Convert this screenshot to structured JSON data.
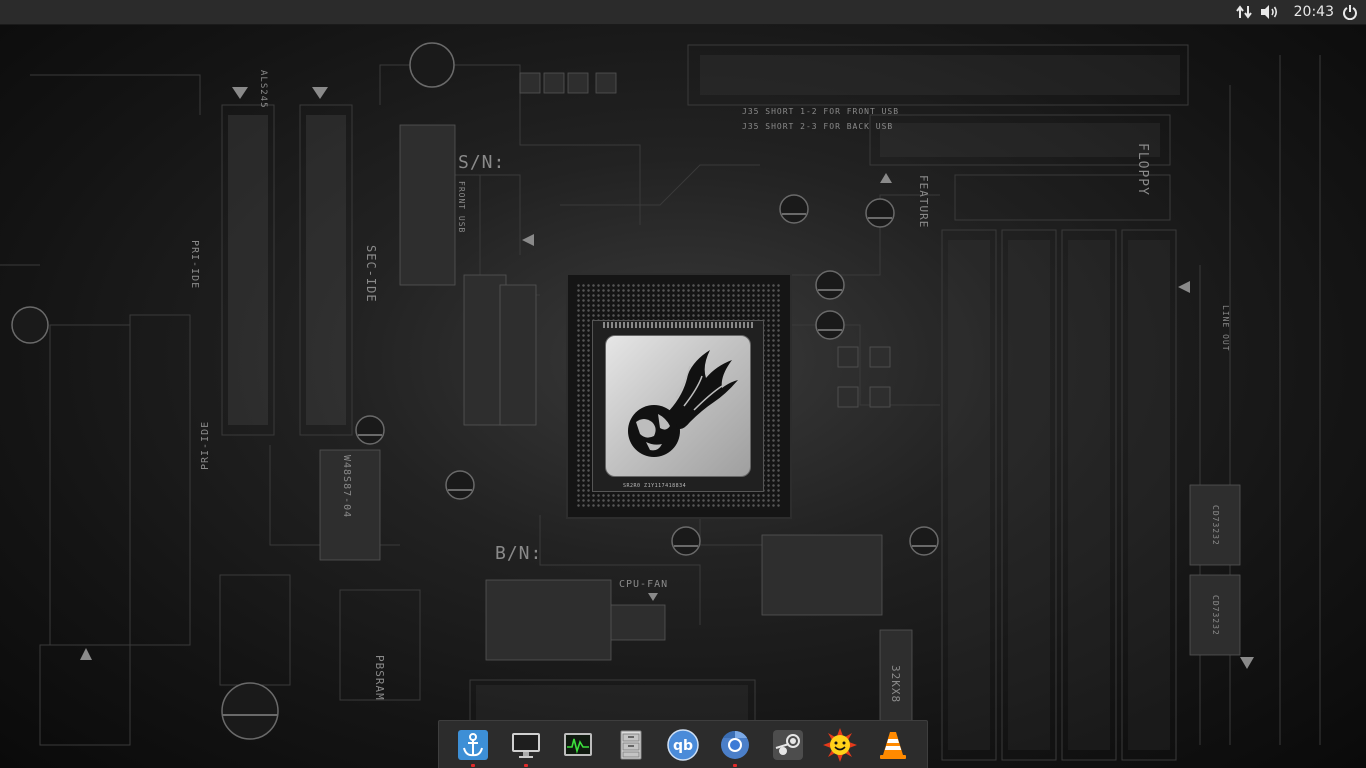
{
  "panel": {
    "clock": "20:43",
    "icons": {
      "network": "network-transfer-icon",
      "volume": "volume-icon",
      "power": "power-icon"
    }
  },
  "wallpaper": {
    "labels": {
      "sn": "S/N:",
      "bn": "B/N:",
      "floppy": "FLOPPY",
      "feature": "FEATURE",
      "sec_ide": "SEC-IDE",
      "pri_ide": "PRI-IDE",
      "pri_ide_lower": "PRI-IDE",
      "front_usb": "FRONT USB",
      "cpu_fan": "CPU-FAN",
      "pbsram": "PBSRAM",
      "chip_code": "W48S87-04",
      "j35_line1": "J35 SHORT 1-2 FOR FRONT USB",
      "j35_line2": "J35 SHORT 2-3 FOR BACK USB",
      "line_out": "LINE OUT",
      "mem_chip": "32KX8",
      "cpu_code": "SR2R0 Z1Y117418834",
      "ic_1": "ALS245",
      "ic_2": "CD73232",
      "ic_3": "CD73232"
    }
  },
  "dock": {
    "items": [
      {
        "name": "launcher",
        "icon": "anchor-icon",
        "running": true
      },
      {
        "name": "computer",
        "icon": "monitor-icon",
        "running": true
      },
      {
        "name": "system-monitor",
        "icon": "activity-monitor-icon",
        "running": false
      },
      {
        "name": "file-cabinet",
        "icon": "file-cabinet-icon",
        "running": false
      },
      {
        "name": "qbittorrent",
        "icon": "qbittorrent-icon",
        "running": false
      },
      {
        "name": "chromium",
        "icon": "chromium-icon",
        "running": true
      },
      {
        "name": "steam",
        "icon": "steam-icon",
        "running": false
      },
      {
        "name": "redshift",
        "icon": "sun-smiley-icon",
        "running": false
      },
      {
        "name": "vlc",
        "icon": "vlc-cone-icon",
        "running": false
      }
    ]
  },
  "colors": {
    "panel_bg": "#2b2b2b",
    "dock_bg": "#2c2c2c",
    "running_indicator": "#e02b2b",
    "text": "#e8e8e8"
  }
}
